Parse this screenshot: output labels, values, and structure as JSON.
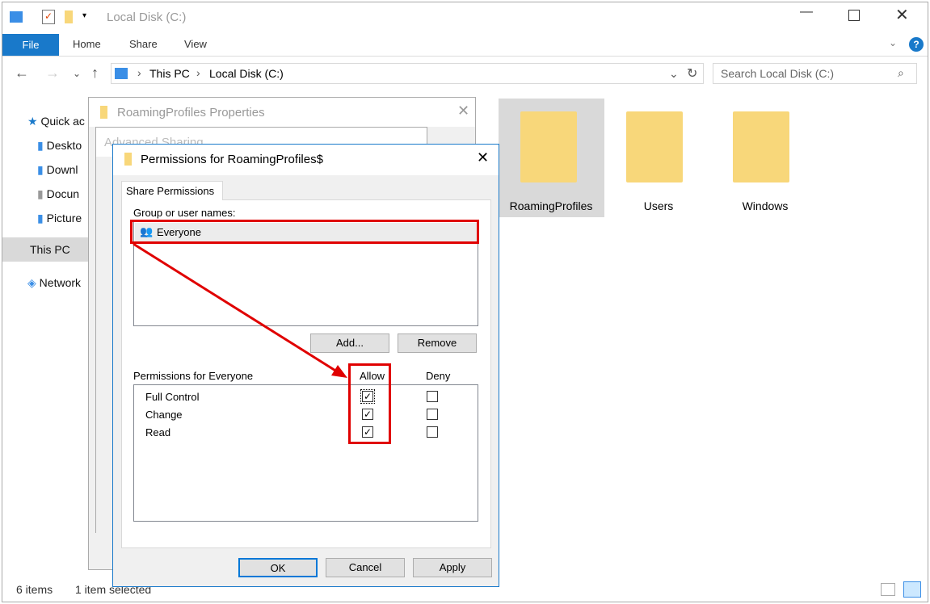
{
  "window": {
    "title": "Local Disk (C:)",
    "minimize_icon": "minimize-icon",
    "maximize_icon": "maximize-icon",
    "close_icon": "close-icon"
  },
  "ribbon": {
    "file": "File",
    "tabs": [
      "Home",
      "Share",
      "View"
    ]
  },
  "address": {
    "crumbs": [
      "This PC",
      "Local Disk (C:)"
    ],
    "search_placeholder": "Search Local Disk (C:)"
  },
  "sidebar": [
    "Quick ac",
    "Deskto",
    "Downl",
    "Docun",
    "Picture",
    "This PC",
    "Network"
  ],
  "folders": [
    "RoamingProfiles",
    "Users",
    "Windows"
  ],
  "status": {
    "items": "6 items",
    "selected": "1 item selected"
  },
  "properties_dialog": {
    "title": "RoamingProfiles Properties"
  },
  "advanced_dialog": {
    "title": "Advanced Sharing"
  },
  "permissions_dialog": {
    "title": "Permissions for RoamingProfiles$",
    "tab": "Share Permissions",
    "group_label": "Group or user names:",
    "users": [
      "Everyone"
    ],
    "add": "Add...",
    "remove": "Remove",
    "perm_label": "Permissions for Everyone",
    "allow": "Allow",
    "deny": "Deny",
    "permissions": [
      {
        "name": "Full Control",
        "allow": true,
        "deny": false
      },
      {
        "name": "Change",
        "allow": true,
        "deny": false
      },
      {
        "name": "Read",
        "allow": true,
        "deny": false
      }
    ],
    "ok": "OK",
    "cancel": "Cancel",
    "apply": "Apply"
  },
  "annotation_color": "#e00000"
}
